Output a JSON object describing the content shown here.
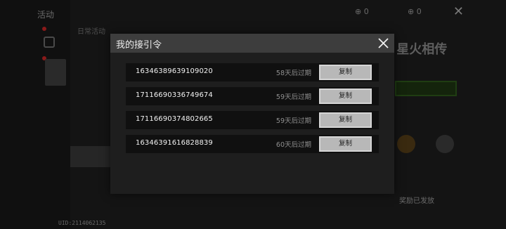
{
  "background": {
    "title": "活动",
    "menu_items": [
      "日常活动",
      "",
      "",
      "",
      "",
      "",
      "",
      "",
      ""
    ],
    "top_right_values": [
      "0",
      "0"
    ],
    "right_title": "志 星火相传",
    "right_status": "奖励已发放",
    "uid": "UID:2114062135"
  },
  "modal": {
    "title": "我的接引令",
    "close_icon": "close-x-icon",
    "codes": [
      {
        "code": "16346389639109020",
        "expiry": "58天后过期",
        "copy_label": "复制"
      },
      {
        "code": "17116690336749674",
        "expiry": "59天后过期",
        "copy_label": "复制"
      },
      {
        "code": "17116690374802665",
        "expiry": "59天后过期",
        "copy_label": "复制"
      },
      {
        "code": "16346391616828839",
        "expiry": "60天后过期",
        "copy_label": "复制"
      }
    ]
  },
  "colors": {
    "modal_header": "#3d3d3d",
    "modal_body": "#1e1e1e",
    "row_bg": "#101010",
    "copy_button": "#b8b8b8"
  }
}
